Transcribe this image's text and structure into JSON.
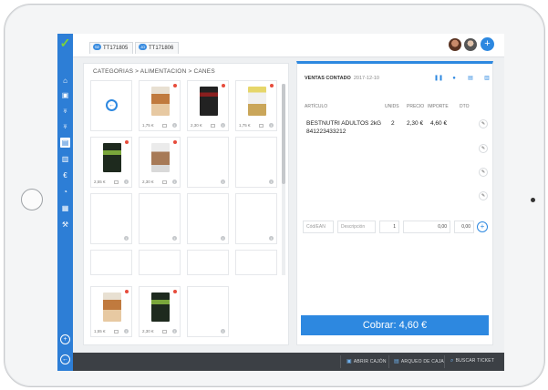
{
  "tabs": [
    {
      "badge": "SE",
      "label": "TT171805"
    },
    {
      "badge": "JO",
      "label": "TT171806"
    }
  ],
  "sidebar": {
    "items": [
      "home-icon",
      "save-icon",
      "cart-icon",
      "cart-alt-icon",
      "document-icon",
      "stats-icon",
      "euro-icon",
      "pie-chart-icon",
      "calendar-icon",
      "wrench-icon"
    ],
    "active_item": "document-icon"
  },
  "catalog": {
    "breadcrumb": "CATEGORIAS > ALIMENTACION > CANES",
    "products": [
      {
        "price": "1,75 €"
      },
      {
        "price": "2,30 €"
      },
      {
        "price": "1,75 €"
      },
      {
        "price": "2,55 €"
      },
      {
        "price": "2,30 €"
      }
    ],
    "bottom_products": [
      {
        "price": "1,55 €"
      },
      {
        "price": "2,30 €"
      }
    ]
  },
  "sale": {
    "title": "VENTAS CONTADO",
    "date": "2017-12-10",
    "columns": [
      "ARTÍCULO",
      "UNIDS",
      "PRECIO",
      "IMPORTE",
      "DTO"
    ],
    "line": {
      "name": "BESTNUTRI ADULTOS 2kG",
      "code": "841223433212",
      "units": "2",
      "price": "2,30 €",
      "amount": "4,60 €"
    },
    "entry": {
      "code_placeholder": "Cód/EAN",
      "desc_placeholder": "Descripción",
      "qty": "1",
      "price": "0,00",
      "discount": "0,00"
    },
    "charge_label": "Cobrar: 4,60 €"
  },
  "footer": {
    "buttons": [
      "ABRIR CAJÓN",
      "ARQUEO DE CAJA",
      "BUSCAR TICKET"
    ]
  },
  "colors": {
    "accent": "#2d88e0",
    "sidebar": "#2d7ed6",
    "footer": "#3c4045",
    "logo": "#7cd33a"
  }
}
